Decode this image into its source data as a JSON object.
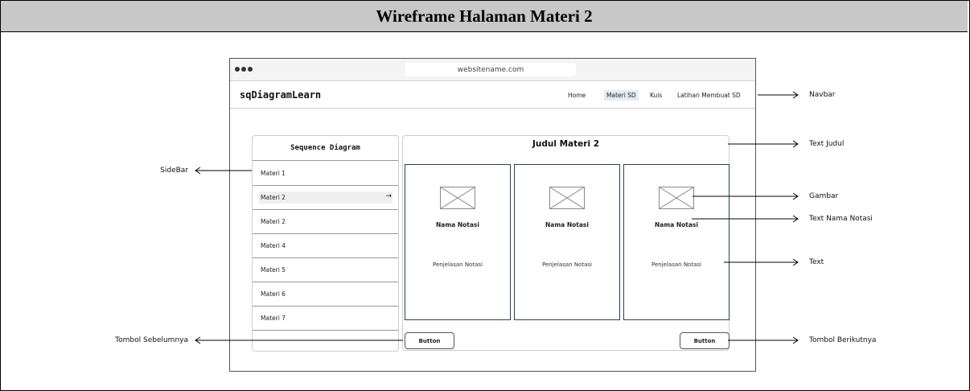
{
  "page_title": "Wireframe Halaman Materi 2",
  "browser": {
    "url": "websitename.com"
  },
  "navbar": {
    "brand": "sqDiagramLearn",
    "links": [
      "Home",
      "Materi SD",
      "Kuis",
      "Latihan Membuat SD"
    ],
    "active": "Materi SD"
  },
  "sidebar": {
    "title": "Sequence Diagram",
    "items": [
      "Materi 1",
      "Materi 2",
      "Materi 2",
      "Materi 4",
      "Materi 5",
      "Materi 6",
      "Materi 7"
    ],
    "selected_arrow": "→"
  },
  "content": {
    "title": "Judul Materi 2",
    "cards": [
      {
        "name": "Nama Notasi",
        "desc": "Penjelasan Notasi"
      },
      {
        "name": "Nama Notasi",
        "desc": "Penjelasan Notasi"
      },
      {
        "name": "Nama Notasi",
        "desc": "Penjelasan Notasi"
      }
    ],
    "prev_button": "Button",
    "next_button": "Button"
  },
  "annotations": {
    "navbar": "Navbar",
    "text_judul": "Text Judul",
    "gambar": "Gambar",
    "text_nama_notasi": "Text Nama Notasi",
    "text": "Text",
    "tombol_berikutnya": "Tombol Berikutnya",
    "sidebar": "SideBar",
    "tombol_sebelumnya": "Tombol Sebelumnya"
  }
}
